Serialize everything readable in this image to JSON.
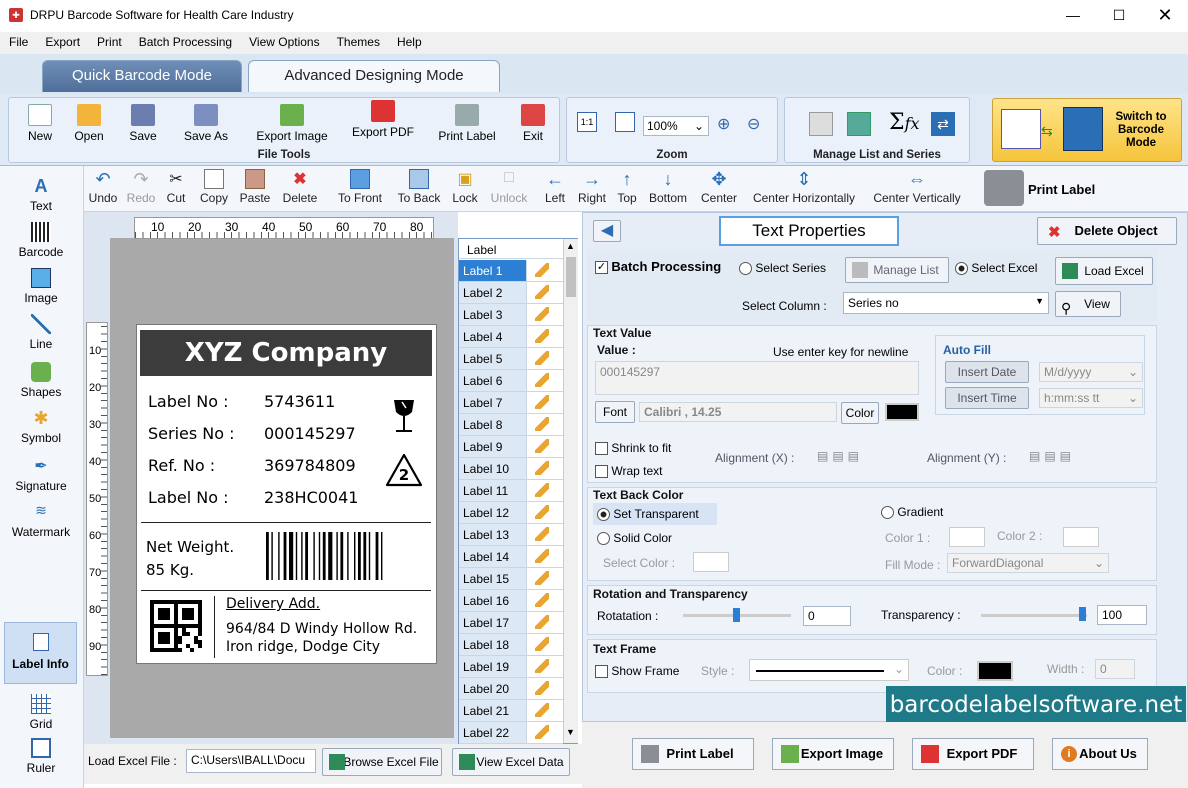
{
  "window": {
    "title": "DRPU Barcode Software for Health Care Industry"
  },
  "menu": [
    "File",
    "Export",
    "Print",
    "Batch Processing",
    "View Options",
    "Themes",
    "Help"
  ],
  "modes": {
    "quick": "Quick Barcode Mode",
    "advanced": "Advanced Designing Mode"
  },
  "ribbon": {
    "file_tools": {
      "title": "File Tools",
      "buttons": [
        "New",
        "Open",
        "Save",
        "Save As",
        "Export Image",
        "Export PDF",
        "Print Label",
        "Exit"
      ]
    },
    "zoom": {
      "title": "Zoom",
      "value": "100%"
    },
    "manage": {
      "title": "Manage List and Series"
    },
    "switch": "Switch to Barcode Mode"
  },
  "edit_toolbar": [
    "Undo",
    "Redo",
    "Cut",
    "Copy",
    "Paste",
    "Delete",
    "To Front",
    "To Back",
    "Lock",
    "Unlock",
    "Left",
    "Right",
    "Top",
    "Bottom",
    "Center",
    "Center Horizontally",
    "Center Vertically"
  ],
  "print_label": "Print Label",
  "sidebar": [
    "Text",
    "Barcode",
    "Image",
    "Line",
    "Shapes",
    "Symbol",
    "Signature",
    "Watermark",
    "Label Info",
    "Grid",
    "Ruler"
  ],
  "ruler": {
    "top": [
      "10",
      "20",
      "30",
      "40",
      "50",
      "60",
      "70",
      "80"
    ],
    "left": [
      "10",
      "20",
      "30",
      "40",
      "50",
      "60",
      "70",
      "80",
      "90"
    ]
  },
  "label": {
    "company": "XYZ Company",
    "rows": [
      {
        "k": "Label No :",
        "v": "5743611"
      },
      {
        "k": "Series No :",
        "v": "000145297"
      },
      {
        "k": "Ref. No :",
        "v": "369784809"
      },
      {
        "k": "Label No :",
        "v": "238HC0041"
      }
    ],
    "weight": "Net Weight.",
    "weight_val": "85 Kg.",
    "delivery": "Delivery Add.",
    "addr1": "964/84 D Windy Hollow Rd.",
    "addr2": "Iron ridge, Dodge City",
    "recycle": "2"
  },
  "label_list": {
    "header": "Label",
    "items": [
      "Label 1",
      "Label 2",
      "Label 3",
      "Label 4",
      "Label 5",
      "Label 6",
      "Label 7",
      "Label 8",
      "Label 9",
      "Label 10",
      "Label 11",
      "Label 12",
      "Label 13",
      "Label 14",
      "Label 15",
      "Label 16",
      "Label 17",
      "Label 18",
      "Label 19",
      "Label 20",
      "Label 21",
      "Label 22"
    ]
  },
  "load_excel": {
    "label": "Load Excel File :",
    "path": "C:\\Users\\IBALL\\Docu",
    "browse": "Browse Excel File",
    "view": "View Excel Data"
  },
  "props": {
    "title": "Text Properties",
    "delete": "Delete Object",
    "batch": "Batch Processing",
    "select_series": "Select Series",
    "manage_list": "Manage List",
    "select_excel": "Select Excel",
    "load_excel": "Load Excel",
    "select_column": "Select Column :",
    "column_value": "Series no",
    "view": "View",
    "text_value": "Text Value",
    "value": "Value :",
    "hint": "Use enter key for newline",
    "value_text": "000145297",
    "font": "Font",
    "font_value": "Calibri , 14.25",
    "color": "Color",
    "auto_fill": "Auto Fill",
    "insert_date": "Insert Date",
    "date_fmt": "M/d/yyyy",
    "insert_time": "Insert Time",
    "time_fmt": "h:mm:ss tt",
    "shrink": "Shrink to fit",
    "wrap": "Wrap text",
    "align_x": "Alignment (X) :",
    "align_y": "Alignment (Y) :",
    "back_color": "Text Back Color",
    "transparent": "Set Transparent",
    "solid": "Solid Color",
    "select_color": "Select Color :",
    "gradient": "Gradient",
    "color1": "Color 1 :",
    "color2": "Color 2 :",
    "fill_mode": "Fill Mode :",
    "fill_value": "ForwardDiagonal",
    "rotation": "Rotation and Transparency",
    "rot_label": "Rotatation :",
    "rot_value": "0",
    "trans_label": "Transparency :",
    "trans_value": "100",
    "frame": "Text Frame",
    "show_frame": "Show Frame",
    "style": "Style :",
    "fcolor": "Color :",
    "width": "Width :",
    "width_value": "0"
  },
  "actions": {
    "print": "Print Label",
    "export_image": "Export Image",
    "export_pdf": "Export PDF",
    "about": "About Us"
  },
  "watermark": "barcodelabelsoftware.net"
}
